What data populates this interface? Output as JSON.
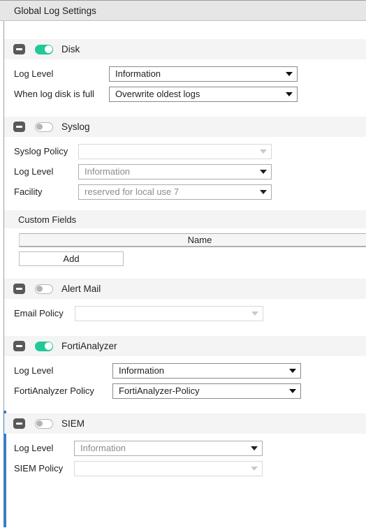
{
  "window": {
    "title": "Global Log Settings"
  },
  "icons": {
    "collapse": "collapse-minus-icon",
    "caret": "chevron-down-icon"
  },
  "colors": {
    "toggle_on": "#20c997",
    "toggle_off_border": "#b5b5b5",
    "focus_bar": "#3b7fc4",
    "titlebar_bg": "#e6e6e6",
    "section_header_bg": "#f4f4f4"
  },
  "sections": [
    {
      "id": "disk",
      "title": "Disk",
      "enabled": true,
      "toggle_state": "on",
      "rows": [
        {
          "label": "Log Level",
          "value": "Information",
          "placeholder": "",
          "state": "enabled",
          "label_width": 150,
          "field_width": 270
        },
        {
          "label": "When log disk is full",
          "value": "Overwrite oldest logs",
          "placeholder": "",
          "state": "enabled",
          "label_width": 150,
          "field_width": 270
        }
      ]
    },
    {
      "id": "syslog",
      "title": "Syslog",
      "enabled": false,
      "toggle_state": "off",
      "rows": [
        {
          "label": "Syslog Policy",
          "value": "",
          "placeholder": "",
          "state": "disabled",
          "label_width": 106,
          "field_width": 277
        },
        {
          "label": "Log Level",
          "value": "Information",
          "placeholder": "",
          "state": "muted",
          "label_width": 106,
          "field_width": 277
        },
        {
          "label": "Facility",
          "value": "reserved for local use 7",
          "placeholder": "",
          "state": "muted",
          "label_width": 106,
          "field_width": 277
        }
      ],
      "subsection": {
        "title": "Custom Fields",
        "table": {
          "columns": [
            "Name"
          ],
          "rows": []
        },
        "add_label": "Add"
      }
    },
    {
      "id": "alert-mail",
      "title": "Alert Mail",
      "enabled": false,
      "toggle_state": "off",
      "rows": [
        {
          "label": "Email Policy",
          "value": "",
          "placeholder": "",
          "state": "disabled",
          "label_width": 101,
          "field_width": 270
        }
      ]
    },
    {
      "id": "fortianalyzer",
      "title": "FortiAnalyzer",
      "enabled": true,
      "toggle_state": "on",
      "rows": [
        {
          "label": "Log Level",
          "value": "Information",
          "placeholder": "",
          "state": "enabled",
          "label_width": 155,
          "field_width": 270
        },
        {
          "label": "FortiAnalyzer Policy",
          "value": "FortiAnalyzer-Policy",
          "placeholder": "",
          "state": "enabled",
          "label_width": 155,
          "field_width": 270
        }
      ]
    },
    {
      "id": "siem",
      "title": "SIEM",
      "enabled": false,
      "toggle_state": "off",
      "focused": true,
      "rows": [
        {
          "label": "Log Level",
          "value": "Information",
          "placeholder": "",
          "state": "muted",
          "label_width": 100,
          "field_width": 270
        },
        {
          "label": "SIEM Policy",
          "value": "",
          "placeholder": "",
          "state": "disabled",
          "label_width": 100,
          "field_width": 270
        }
      ]
    }
  ]
}
